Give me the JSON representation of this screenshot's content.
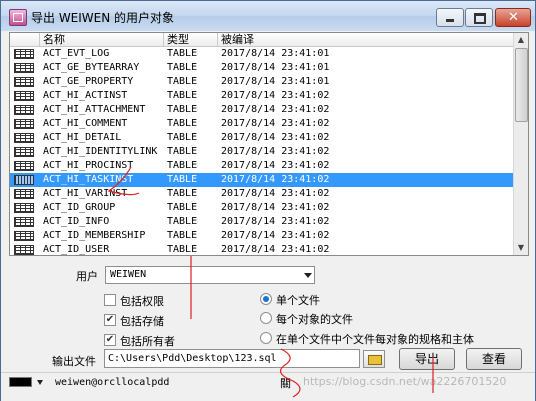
{
  "window": {
    "title": "导出 WEIWEN 的用户对象"
  },
  "table": {
    "columns": [
      "名称",
      "类型",
      "被编译"
    ],
    "rows": [
      {
        "name": "ACT_EVT_LOG",
        "type": "TABLE",
        "compiled": "2017/8/14 23:41:01"
      },
      {
        "name": "ACT_GE_BYTEARRAY",
        "type": "TABLE",
        "compiled": "2017/8/14 23:41:01"
      },
      {
        "name": "ACT_GE_PROPERTY",
        "type": "TABLE",
        "compiled": "2017/8/14 23:41:01"
      },
      {
        "name": "ACT_HI_ACTINST",
        "type": "TABLE",
        "compiled": "2017/8/14 23:41:02"
      },
      {
        "name": "ACT_HI_ATTACHMENT",
        "type": "TABLE",
        "compiled": "2017/8/14 23:41:02"
      },
      {
        "name": "ACT_HI_COMMENT",
        "type": "TABLE",
        "compiled": "2017/8/14 23:41:02"
      },
      {
        "name": "ACT_HI_DETAIL",
        "type": "TABLE",
        "compiled": "2017/8/14 23:41:02"
      },
      {
        "name": "ACT_HI_IDENTITYLINK",
        "type": "TABLE",
        "compiled": "2017/8/14 23:41:02"
      },
      {
        "name": "ACT_HI_PROCINST",
        "type": "TABLE",
        "compiled": "2017/8/14 23:41:02"
      },
      {
        "name": "ACT_HI_TASKINST",
        "type": "TABLE",
        "compiled": "2017/8/14 23:41:02"
      },
      {
        "name": "ACT_HI_VARINST",
        "type": "TABLE",
        "compiled": "2017/8/14 23:41:02"
      },
      {
        "name": "ACT_ID_GROUP",
        "type": "TABLE",
        "compiled": "2017/8/14 23:41:02"
      },
      {
        "name": "ACT_ID_INFO",
        "type": "TABLE",
        "compiled": "2017/8/14 23:41:02"
      },
      {
        "name": "ACT_ID_MEMBERSHIP",
        "type": "TABLE",
        "compiled": "2017/8/14 23:41:02"
      },
      {
        "name": "ACT_ID_USER",
        "type": "TABLE",
        "compiled": "2017/8/14 23:41:02"
      }
    ],
    "selected_row": "ACT_HI_TASKINST"
  },
  "user": {
    "label": "用户",
    "value": "WEIWEN"
  },
  "options": {
    "include_privileges": "包括权限",
    "include_storage": "包括存储",
    "include_owner": "包括所有者"
  },
  "file_mode": {
    "single_file": "单个文件",
    "file_per_object": "每个对象的文件",
    "spec_and_body": "在单个文件中个文件每对象的规格和主体"
  },
  "output": {
    "label": "输出文件",
    "path": "C:\\Users\\Pdd\\Desktop\\123.sql"
  },
  "buttons": {
    "export": "导出",
    "view": "查看",
    "close_fragment": "關"
  },
  "status": {
    "connection": "weiwen@orcllocalpdd"
  },
  "watermark": "https://blog.csdn.net/wa2226701520",
  "colors": {
    "selection": "#3399ff",
    "annotation": "#e02020"
  }
}
